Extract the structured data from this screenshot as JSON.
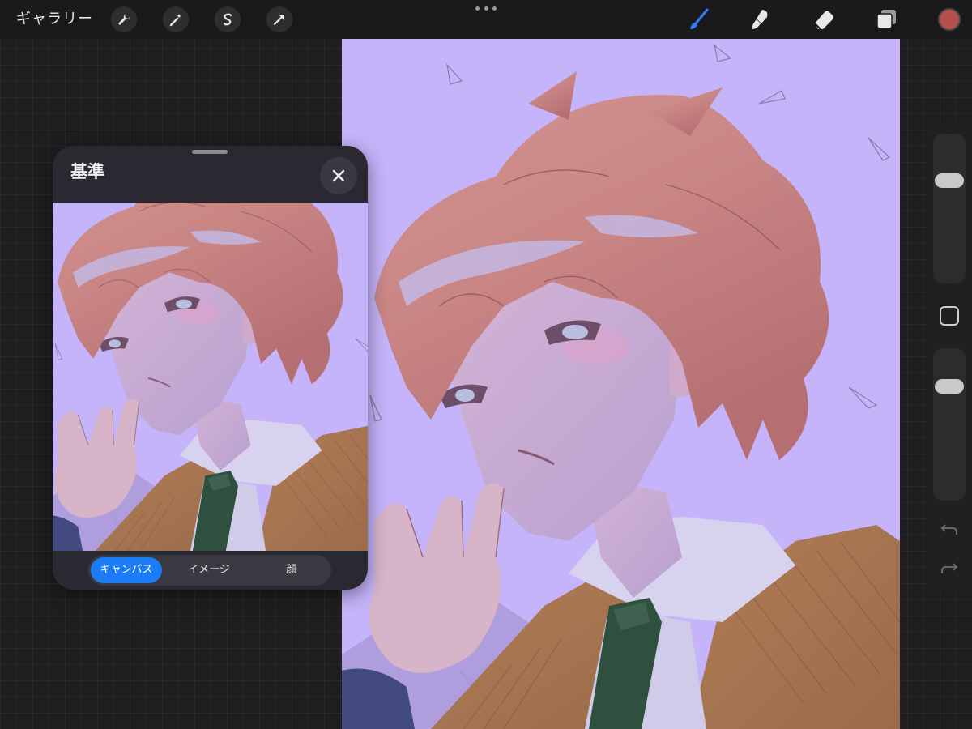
{
  "toolbar": {
    "gallery_label": "ギャラリー",
    "left_tools": [
      "wrench-icon",
      "magic-wand-icon",
      "selection-s-icon",
      "transform-arrow-icon"
    ],
    "right_tools": [
      "brush-icon",
      "smudge-icon",
      "eraser-icon",
      "layers-icon"
    ],
    "active_tool": "brush-icon",
    "active_tool_color": "#2f7cf6",
    "current_color": "#b5504a"
  },
  "canvas": {
    "background_color": "#c5b4fa"
  },
  "sidebar": {
    "brush_size": 0.28,
    "opacity": 0.2,
    "items": [
      "brush-size-slider",
      "modify-button",
      "opacity-slider",
      "undo-icon",
      "redo-icon"
    ]
  },
  "reference": {
    "title": "基準",
    "tabs": [
      "キャンバス",
      "イメージ",
      "顔"
    ],
    "active_tab": "キャンバス",
    "accent_color": "#1b7cf5"
  }
}
